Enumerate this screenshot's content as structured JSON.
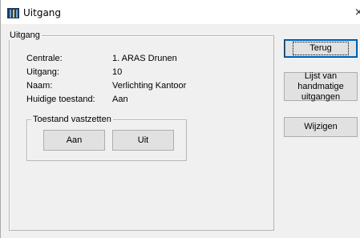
{
  "window": {
    "title": "Uitgang",
    "close_glyph": "×"
  },
  "group": {
    "title": "Uitgang",
    "fields": [
      {
        "label": "Centrale:",
        "value": "1. ARAS Drunen"
      },
      {
        "label": "Uitgang:",
        "value": "10"
      },
      {
        "label": "Naam:",
        "value": "Verlichting Kantoor"
      },
      {
        "label": "Huidige toestand:",
        "value": "Aan"
      }
    ]
  },
  "lock": {
    "title": "Toestand vastzetten",
    "on_label": "Aan",
    "off_label": "Uit"
  },
  "buttons": {
    "back_label": "Terug",
    "list_line1": "Lijst van handmatige",
    "list_line2": "uitgangen",
    "edit_label": "Wijzigen"
  },
  "icons": {
    "app": "building-icon",
    "close": "close-icon"
  },
  "colors": {
    "focus_accent": "#0078d7",
    "app_icon": "#1e3a5f"
  }
}
